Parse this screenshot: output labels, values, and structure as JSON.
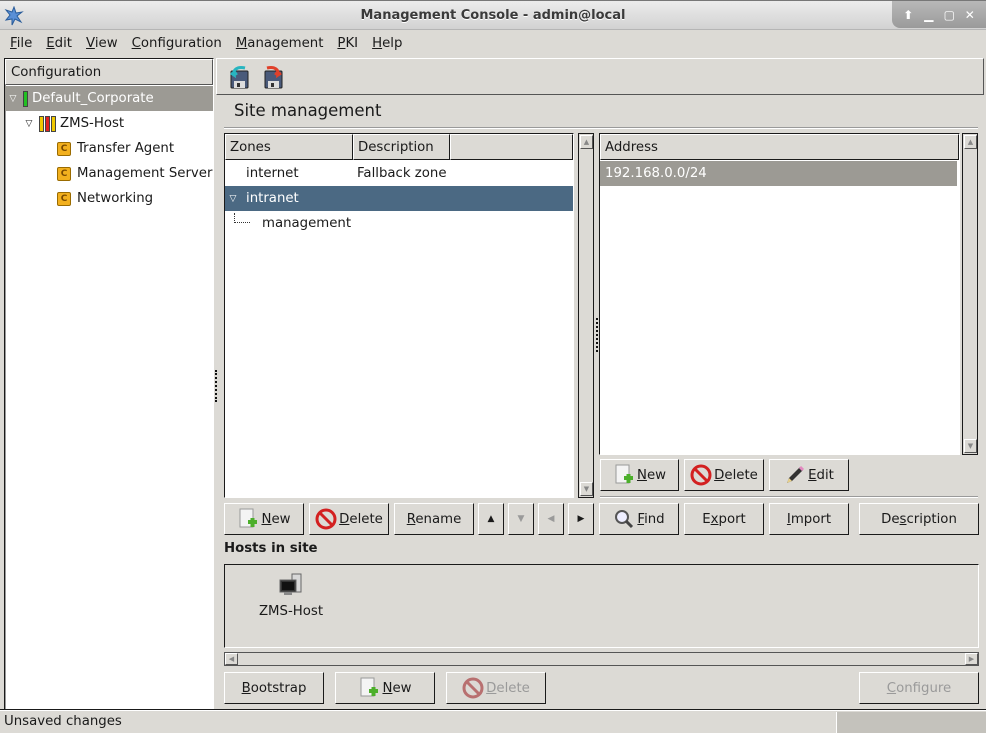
{
  "window": {
    "title": "Management Console - admin@local",
    "controls": [
      "up-arrow",
      "minimize",
      "maximize",
      "close"
    ]
  },
  "menubar": [
    {
      "label": "File",
      "mnemonic": "F"
    },
    {
      "label": "Edit",
      "mnemonic": "E"
    },
    {
      "label": "View",
      "mnemonic": "V"
    },
    {
      "label": "Configuration",
      "mnemonic": "C"
    },
    {
      "label": "Management",
      "mnemonic": "M"
    },
    {
      "label": "PKI",
      "mnemonic": "P"
    },
    {
      "label": "Help",
      "mnemonic": "H"
    }
  ],
  "tree": {
    "header": "Configuration",
    "items": [
      {
        "label": "Default_Corporate",
        "level": 0,
        "expanded": true,
        "selected": true,
        "status_bars": [
          "#22c022"
        ]
      },
      {
        "label": "ZMS-Host",
        "level": 1,
        "expanded": true,
        "status_bars": [
          "#f0c800",
          "#e02020",
          "#f0c800"
        ]
      },
      {
        "label": "Transfer Agent",
        "level": 2,
        "icon": "C"
      },
      {
        "label": "Management Server",
        "level": 2,
        "icon": "C"
      },
      {
        "label": "Networking",
        "level": 2,
        "icon": "C"
      }
    ]
  },
  "toolbar": {
    "commit_tooltip": "commit-icon",
    "revert_tooltip": "revert-icon"
  },
  "site": {
    "title": "Site management",
    "zones_table": {
      "columns": [
        "Zones",
        "Description",
        ""
      ],
      "rows": [
        {
          "name": "internet",
          "description": "Fallback zone",
          "level": 0
        },
        {
          "name": "intranet",
          "description": "",
          "level": 0,
          "expanded": true,
          "selected": true
        },
        {
          "name": "management",
          "description": "",
          "level": 1
        }
      ]
    },
    "address_table": {
      "columns": [
        "Address"
      ],
      "rows": [
        {
          "address": "192.168.0.0/24",
          "selected": true
        }
      ]
    },
    "address_buttons": {
      "new": "New",
      "delete": "Delete",
      "edit": "Edit"
    },
    "zone_buttons": {
      "new": "New",
      "delete": "Delete",
      "rename": "Rename",
      "find": "Find",
      "export": "Export",
      "import": "Import",
      "description": "Description"
    },
    "hosts": {
      "label": "Hosts in site",
      "items": [
        {
          "name": "ZMS-Host"
        }
      ]
    },
    "host_buttons": {
      "bootstrap": "Bootstrap",
      "new": "New",
      "delete": "Delete",
      "configure": "Configure"
    }
  },
  "status": {
    "text": "Unsaved changes"
  }
}
